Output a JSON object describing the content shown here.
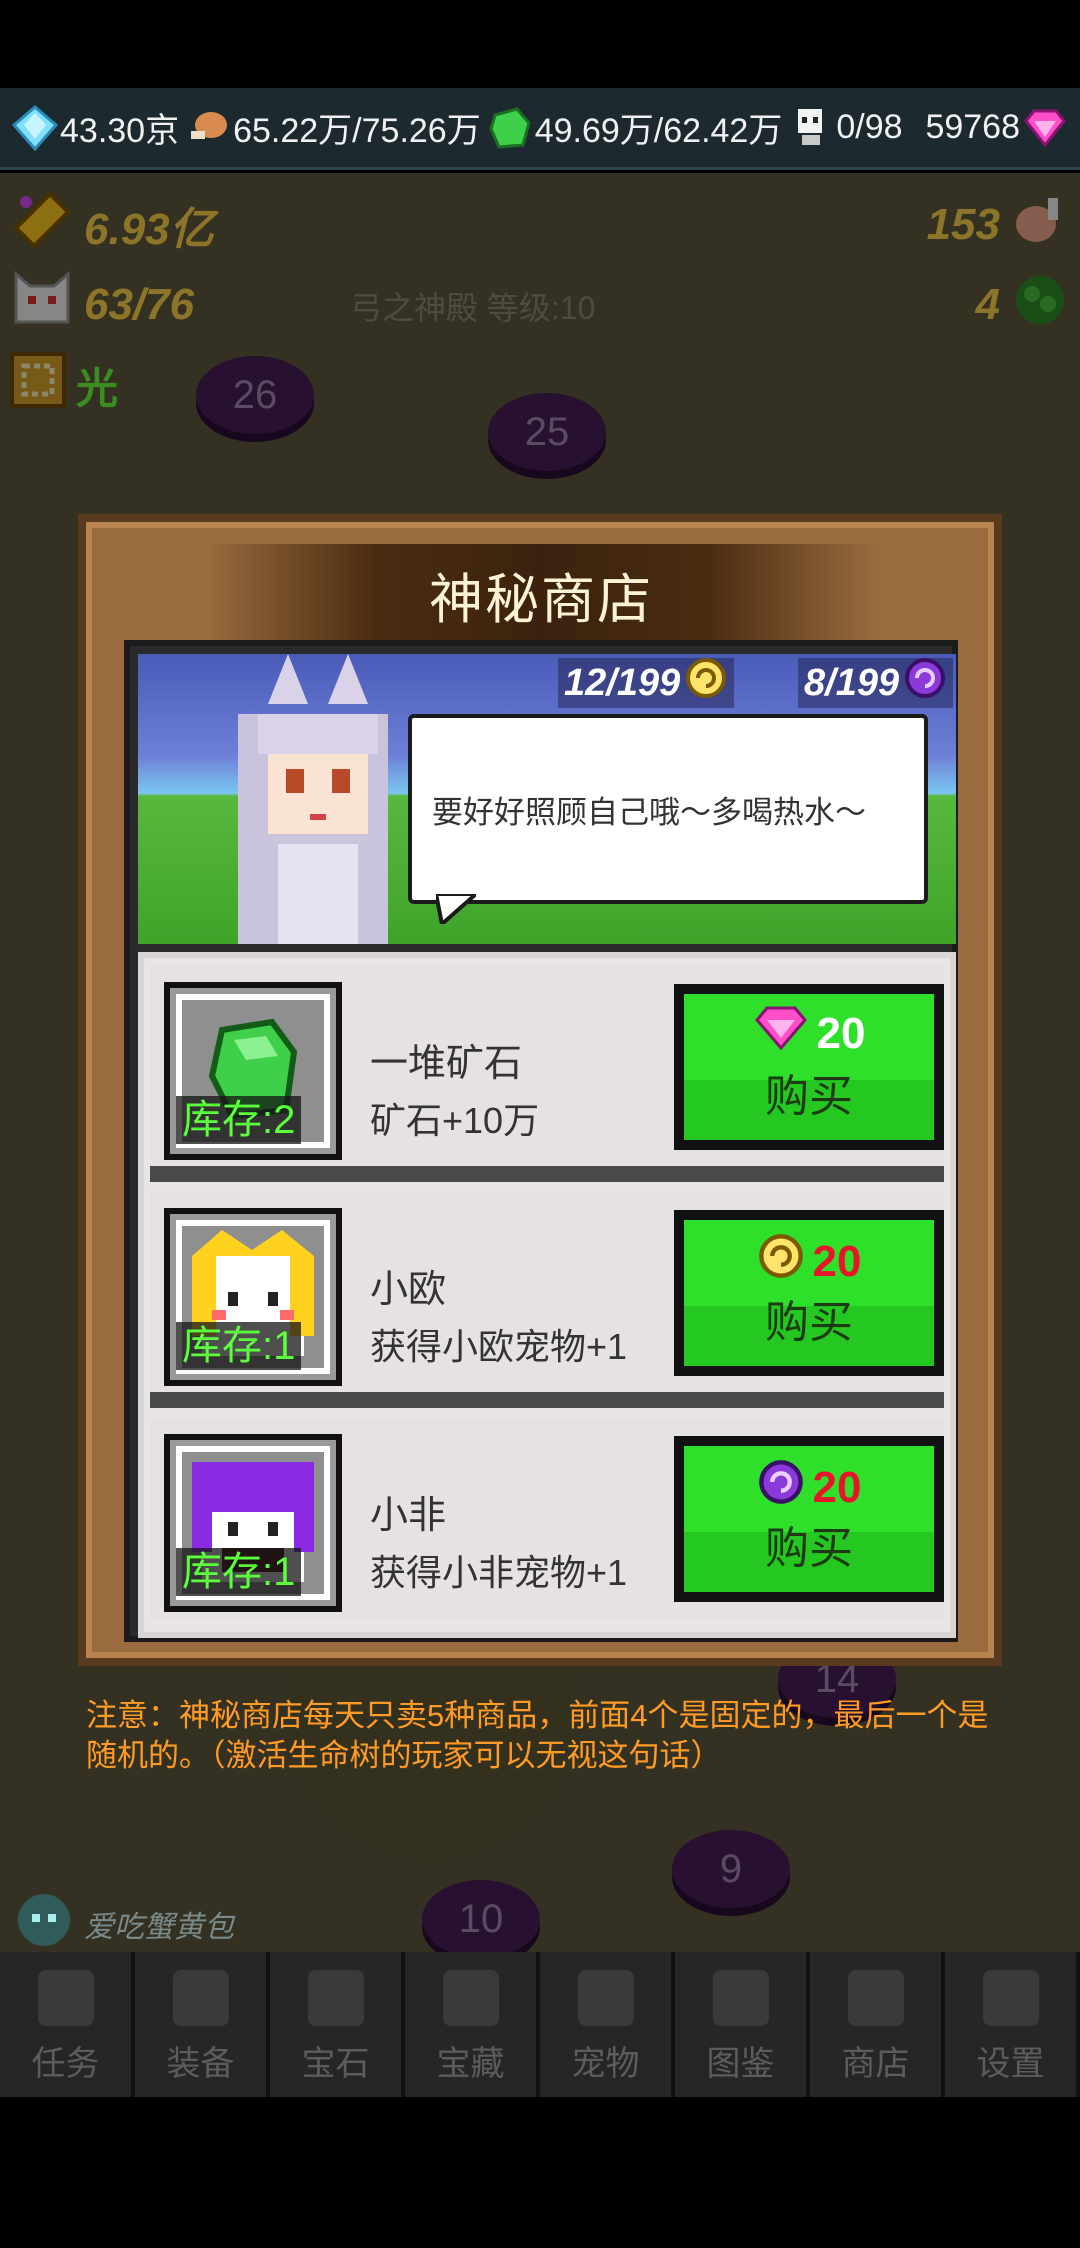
{
  "resources": {
    "diamond": "43.30京",
    "meat": "65.22万/75.26万",
    "ore": "49.69万/62.42万",
    "population": "0/98",
    "gems": "59768"
  },
  "stats": {
    "gold": "6.93亿",
    "pets": "63/76",
    "element": "光",
    "meat_count": "153",
    "herb_count": "4"
  },
  "map": {
    "temple_label": "弓之神殿 等级:10",
    "nodes": [
      "26",
      "25",
      "14",
      "9",
      "10"
    ]
  },
  "shop": {
    "title": "神秘商店",
    "counter_gold": "12/199",
    "counter_purple": "8/199",
    "speech": "要好好照顾自己哦～多喝热水～",
    "items": [
      {
        "stock": "库存:2",
        "name": "一堆矿石",
        "desc": "矿石+10万",
        "price": "20",
        "buy_label": "购买",
        "currency_icon": "pink-gem-icon"
      },
      {
        "stock": "库存:1",
        "name": "小欧",
        "desc": "获得小欧宠物+1",
        "price": "20",
        "buy_label": "购买",
        "currency_icon": "gold-swirl-icon"
      },
      {
        "stock": "库存:1",
        "name": "小非",
        "desc": "获得小非宠物+1",
        "price": "20",
        "buy_label": "购买",
        "currency_icon": "purple-swirl-icon"
      }
    ]
  },
  "note": "注意：神秘商店每天只卖5种商品，前面4个是固定的，最后一个是随机的。（激活生命树的玩家可以无视这句话）",
  "player_name": "爱吃蟹黄包",
  "nav": [
    "任务",
    "装备",
    "宝石",
    "宝藏",
    "宠物",
    "图鉴",
    "商店",
    "设置"
  ],
  "colors": {
    "accent_green": "#2ee02a",
    "price_red": "#e8142a",
    "note_orange": "#ff9b24"
  }
}
